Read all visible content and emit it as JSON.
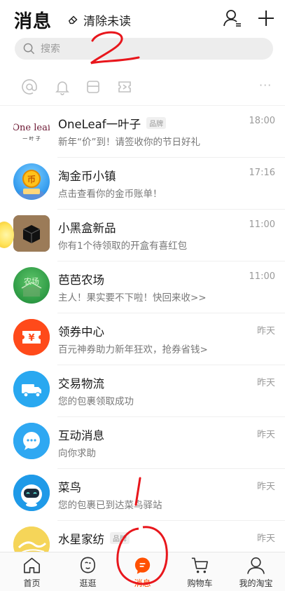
{
  "header": {
    "title": "消息",
    "clear_label": "清除未读"
  },
  "search": {
    "placeholder": "搜索"
  },
  "filters": [
    {
      "icon": "at-icon"
    },
    {
      "icon": "bell-icon"
    },
    {
      "icon": "box-icon"
    },
    {
      "icon": "coupon-icon"
    }
  ],
  "messages": [
    {
      "name": "OneLeaf一叶子",
      "badge": "品牌",
      "preview": "新年“价”到！请签收你的节日好礼",
      "time": "18:00",
      "avatar_text": "One leaf",
      "avatar_sub": "一 叶 子"
    },
    {
      "name": "淘金币小镇",
      "badge": "",
      "preview": "点击查看你的金币账单！",
      "time": "17:16"
    },
    {
      "name": "小黑盒新品",
      "badge": "",
      "preview": "你有1个待领取的开盒有喜红包",
      "time": "11:00"
    },
    {
      "name": "芭芭农场",
      "badge": "",
      "preview": "主人！果实要不下啦！快回来收>>",
      "time": "11:00",
      "avatar_text": "农场"
    },
    {
      "name": "领券中心",
      "badge": "",
      "preview": "百元神券助力新年狂欢，抢券省钱>",
      "time": "昨天",
      "avatar_text": "¥"
    },
    {
      "name": "交易物流",
      "badge": "",
      "preview": "您的包裹领取成功",
      "time": "昨天"
    },
    {
      "name": "互动消息",
      "badge": "",
      "preview": "向你求助",
      "time": "昨天"
    },
    {
      "name": "菜鸟",
      "badge": "",
      "preview": "您的包裹已到达菜鸟驿站",
      "time": "昨天"
    },
    {
      "name": "水星家纺",
      "badge": "品牌",
      "preview": "",
      "time": "昨天"
    }
  ],
  "tabs": [
    {
      "label": "首页",
      "icon": "home-icon"
    },
    {
      "label": "逛逛",
      "icon": "explore-icon"
    },
    {
      "label": "消息",
      "icon": "message-icon",
      "active": true
    },
    {
      "label": "购物车",
      "icon": "cart-icon"
    },
    {
      "label": "我的淘宝",
      "icon": "profile-icon"
    }
  ],
  "annotations": {
    "mark_top": "2",
    "mark_bottom": "1"
  },
  "colors": {
    "accent": "#ff5000",
    "annotation": "#e8161c"
  }
}
